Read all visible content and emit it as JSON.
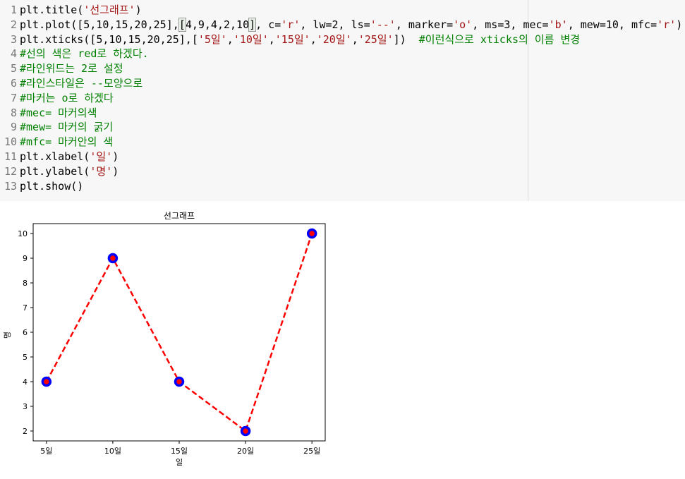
{
  "code": {
    "lines": [
      {
        "n": "1",
        "tokens": [
          {
            "t": "plt.title(",
            "c": "t-kw"
          },
          {
            "t": "'선그래프'",
            "c": "t-str"
          },
          {
            "t": ")",
            "c": "t-kw"
          }
        ]
      },
      {
        "n": "2",
        "tokens": [
          {
            "t": "plt.plot([5,10,15,20,25],",
            "c": "t-kw"
          },
          {
            "t": "[",
            "c": "cursor-box"
          },
          {
            "t": "4,9,4,2,10",
            "c": "t-kw"
          },
          {
            "t": "]",
            "c": "cursor-box"
          },
          {
            "t": ", c=",
            "c": "t-kw"
          },
          {
            "t": "'r'",
            "c": "t-str"
          },
          {
            "t": ", lw=2, ls=",
            "c": "t-kw"
          },
          {
            "t": "'--'",
            "c": "t-str"
          },
          {
            "t": ", marker=",
            "c": "t-kw"
          },
          {
            "t": "'o'",
            "c": "t-str"
          },
          {
            "t": ", ms=3, mec=",
            "c": "t-kw"
          },
          {
            "t": "'b'",
            "c": "t-str"
          },
          {
            "t": ", mew=10, mfc=",
            "c": "t-kw"
          },
          {
            "t": "'r'",
            "c": "t-str"
          },
          {
            "t": ")",
            "c": "t-kw"
          }
        ]
      },
      {
        "n": "3",
        "tokens": [
          {
            "t": "plt.xticks([5,10,15,20,25],[",
            "c": "t-kw"
          },
          {
            "t": "'5일'",
            "c": "t-str"
          },
          {
            "t": ",",
            "c": "t-kw"
          },
          {
            "t": "'10일'",
            "c": "t-str"
          },
          {
            "t": ",",
            "c": "t-kw"
          },
          {
            "t": "'15일'",
            "c": "t-str"
          },
          {
            "t": ",",
            "c": "t-kw"
          },
          {
            "t": "'20일'",
            "c": "t-str"
          },
          {
            "t": ",",
            "c": "t-kw"
          },
          {
            "t": "'25일'",
            "c": "t-str"
          },
          {
            "t": "])  ",
            "c": "t-kw"
          },
          {
            "t": "#이런식으로 xticks의 이름 변경",
            "c": "t-com"
          }
        ]
      },
      {
        "n": "4",
        "tokens": [
          {
            "t": "#선의 색은 red로 하겠다.",
            "c": "t-com"
          }
        ]
      },
      {
        "n": "5",
        "tokens": [
          {
            "t": "#라인위드는 2로 설정",
            "c": "t-com"
          }
        ]
      },
      {
        "n": "6",
        "tokens": [
          {
            "t": "#라인스타일은 --모양으로",
            "c": "t-com"
          }
        ]
      },
      {
        "n": "7",
        "tokens": [
          {
            "t": "#마커는 o로 하겠다",
            "c": "t-com"
          }
        ]
      },
      {
        "n": "8",
        "tokens": [
          {
            "t": "#mec= 마커의색",
            "c": "t-com"
          }
        ]
      },
      {
        "n": "9",
        "tokens": [
          {
            "t": "#mew= 마커의 굵기",
            "c": "t-com"
          }
        ]
      },
      {
        "n": "10",
        "tokens": [
          {
            "t": "#mfc= 마커안의 색",
            "c": "t-com"
          }
        ]
      },
      {
        "n": "11",
        "tokens": [
          {
            "t": "plt.xlabel(",
            "c": "t-kw"
          },
          {
            "t": "'일'",
            "c": "t-str"
          },
          {
            "t": ")",
            "c": "t-kw"
          }
        ]
      },
      {
        "n": "12",
        "tokens": [
          {
            "t": "plt.ylabel(",
            "c": "t-kw"
          },
          {
            "t": "'명'",
            "c": "t-str"
          },
          {
            "t": ")",
            "c": "t-kw"
          }
        ]
      },
      {
        "n": "13",
        "tokens": [
          {
            "t": "plt.show()",
            "c": "t-kw"
          }
        ]
      }
    ]
  },
  "chart_data": {
    "type": "line",
    "title": "선그래프",
    "xlabel": "일",
    "ylabel": "명",
    "x": [
      5,
      10,
      15,
      20,
      25
    ],
    "xtick_labels": [
      "5일",
      "10일",
      "15일",
      "20일",
      "25일"
    ],
    "yticks": [
      2,
      3,
      4,
      5,
      6,
      7,
      8,
      9,
      10
    ],
    "series": [
      {
        "values": [
          4,
          9,
          4,
          2,
          10
        ],
        "line_color": "#ff0000",
        "line_style": "dashed",
        "marker_edge_color": "#0000ff",
        "marker_face_color": "#ff0000"
      }
    ],
    "xlim": [
      4,
      26
    ],
    "ylim": [
      1.6,
      10.4
    ],
    "grid": false
  }
}
